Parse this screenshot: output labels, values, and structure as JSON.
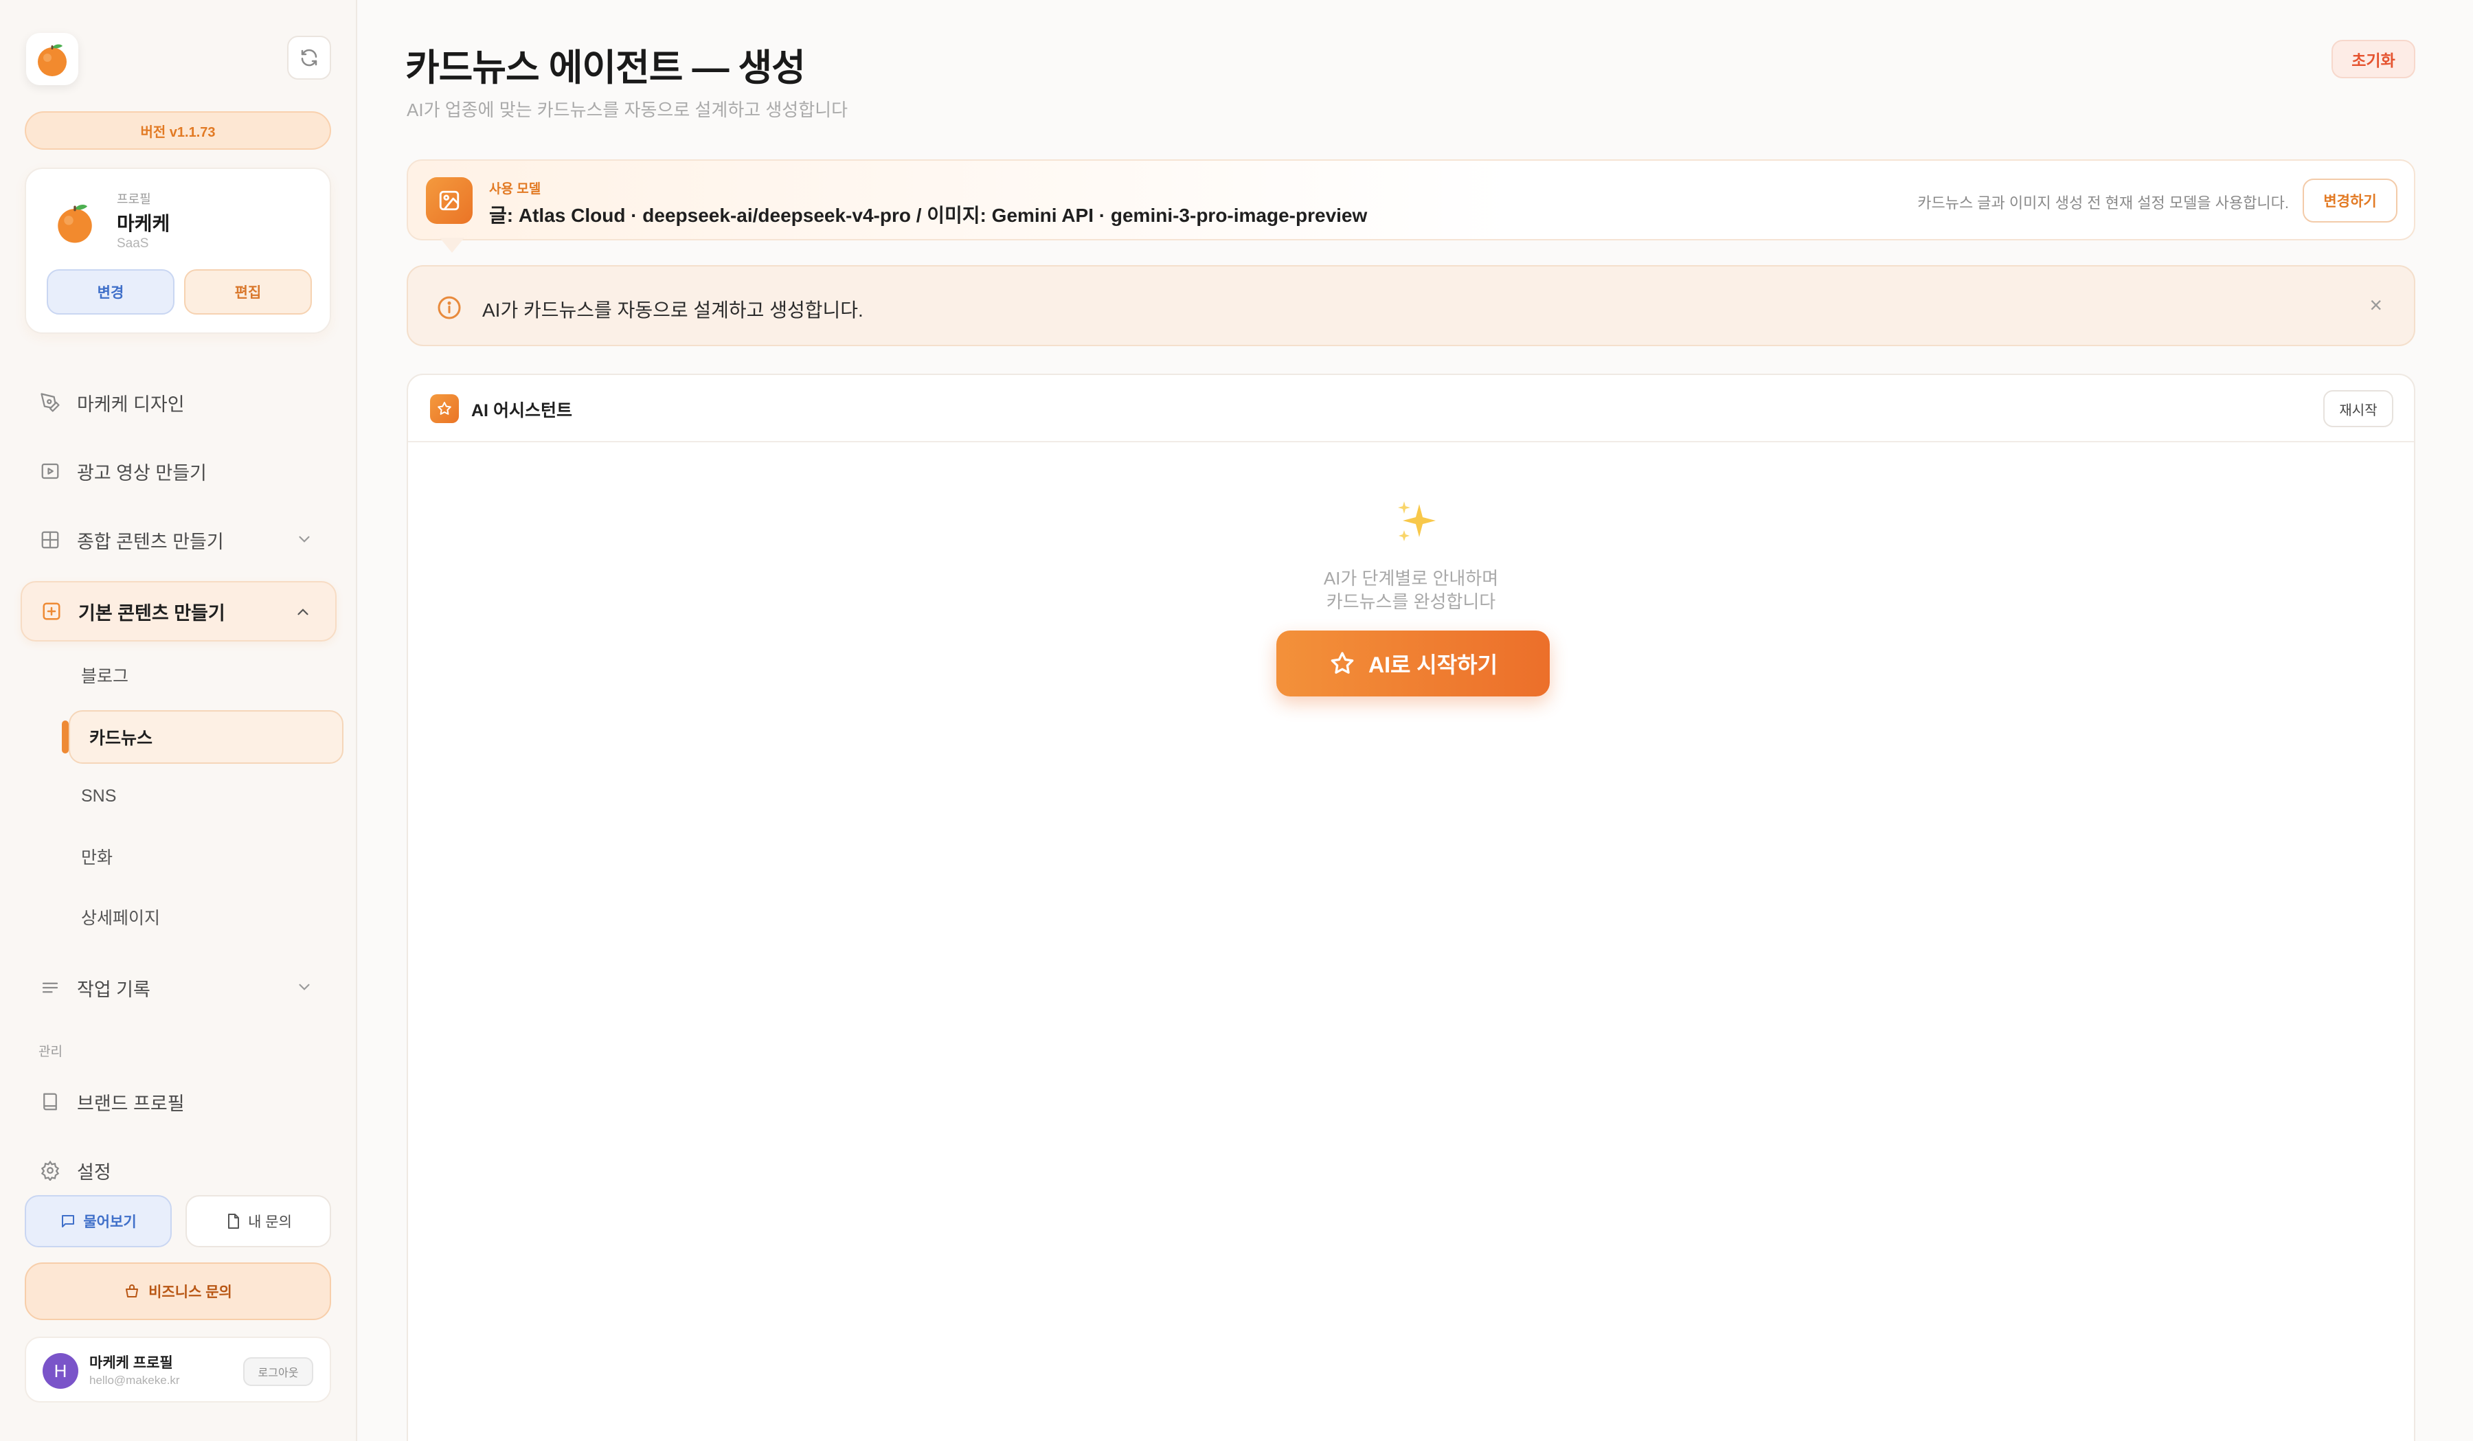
{
  "sidebar": {
    "version": "버전 v1.1.73",
    "profile": {
      "label": "프로필",
      "name": "마케케",
      "sub": "SaaS",
      "change_label": "변경",
      "edit_label": "편집"
    },
    "nav": {
      "design": "마케케 디자인",
      "ad_video": "광고 영상 만들기",
      "combined": "종합 콘텐츠 만들기",
      "basic": "기본 콘텐츠 만들기",
      "sub": {
        "blog": "블로그",
        "cardnews": "카드뉴스",
        "sns": "SNS",
        "comic": "만화",
        "detail": "상세페이지"
      },
      "history": "작업 기록",
      "section_admin": "관리",
      "brand_profile": "브랜드 프로필",
      "settings": "설정"
    },
    "ask_label": "물어보기",
    "my_inquiry_label": "내 문의",
    "business_label": "비즈니스 문의",
    "user": {
      "initial": "H",
      "name": "마케케 프로필",
      "email": "hello@makeke.kr",
      "logout_label": "로그아웃"
    }
  },
  "header": {
    "title": "카드뉴스 에이전트 — 생성",
    "subtitle": "AI가 업종에 맞는 카드뉴스를 자동으로 설계하고 생성합니다",
    "reset_label": "초기화"
  },
  "model_bar": {
    "label": "사용 모델",
    "value": "글: Atlas Cloud · deepseek-ai/deepseek-v4-pro / 이미지: Gemini API · gemini-3-pro-image-preview",
    "note": "카드뉴스 글과 이미지 생성 전 현재 설정 모델을 사용합니다.",
    "change_label": "변경하기"
  },
  "info_bar": {
    "text": "AI가 카드뉴스를 자동으로 설계하고 생성합니다.",
    "close_symbol": "×"
  },
  "assistant": {
    "title": "AI 어시스턴트",
    "restart_label": "재시작",
    "empty_line1": "AI가 단계별로 안내하며",
    "empty_line2": "카드뉴스를 완성합니다",
    "start_label": "AI로 시작하기"
  },
  "colors": {
    "accent": "#ee8a34",
    "accent_dark": "#ea7426",
    "blue": "#3f6fc9",
    "reset_red": "#e5532f"
  },
  "icons": [
    "orange-logo-icon",
    "refresh-icon",
    "pen-tool-icon",
    "video-icon",
    "grid-icon",
    "plus-square-icon",
    "chevron-down-icon",
    "chevron-up-icon",
    "list-icon",
    "book-icon",
    "gear-icon",
    "chat-icon",
    "file-icon",
    "basket-icon",
    "image-icon",
    "info-icon",
    "close-icon",
    "star-icon",
    "sparkles-icon"
  ]
}
